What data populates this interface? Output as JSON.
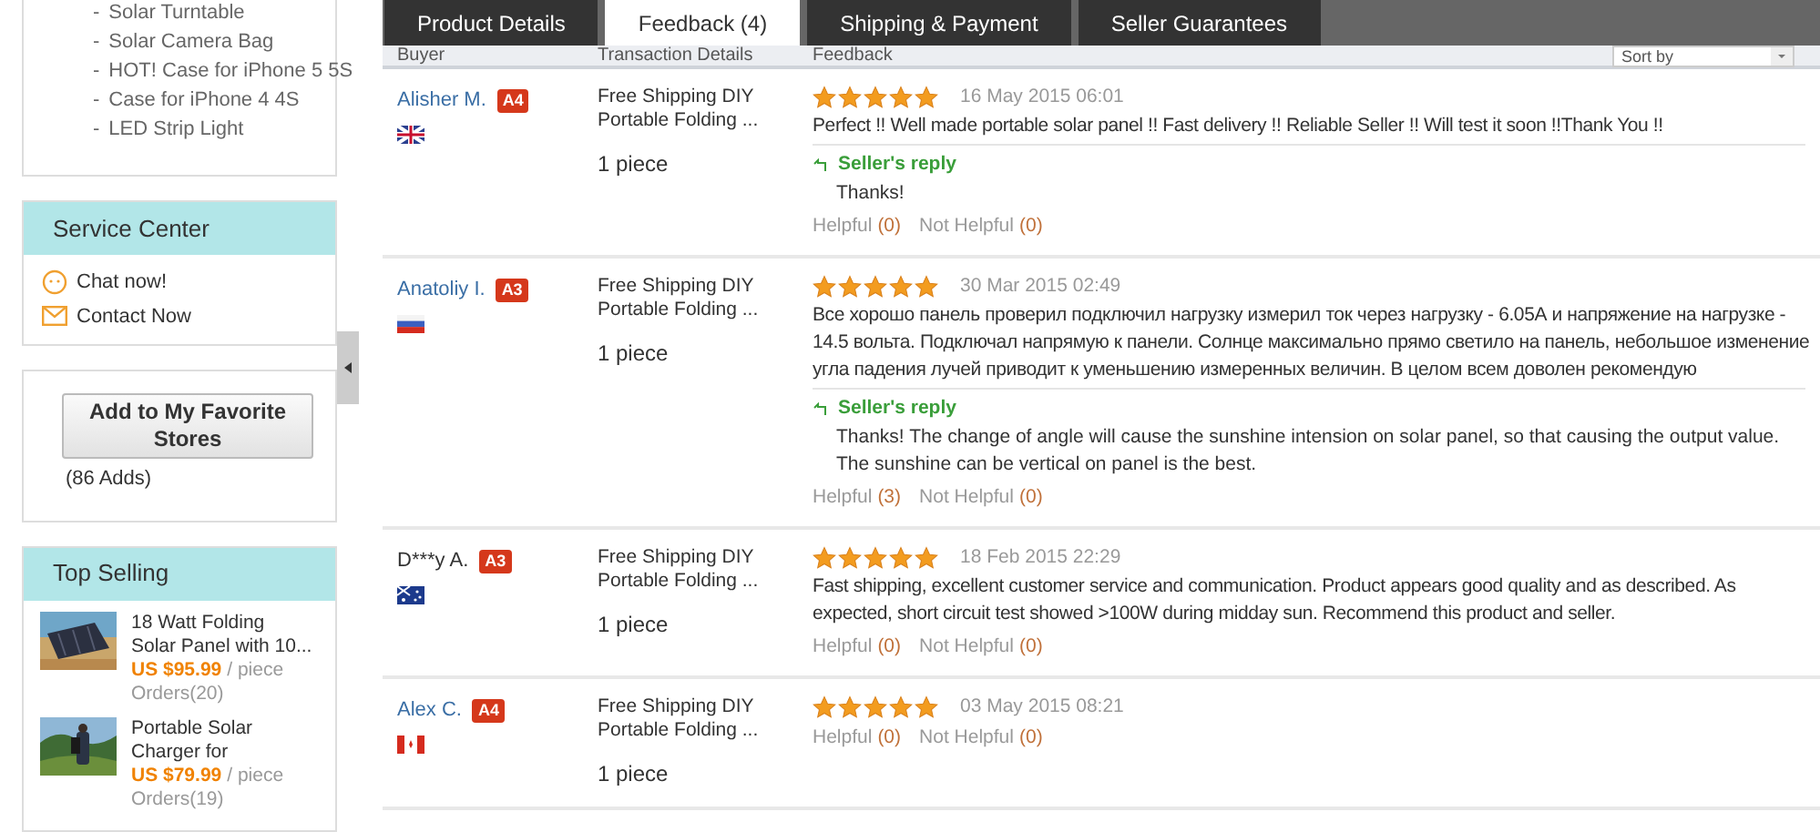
{
  "sidebar": {
    "category_links": [
      {
        "bullet": "-",
        "label": "Solar Turntable"
      },
      {
        "bullet": "-",
        "label": "Solar Camera Bag"
      },
      {
        "bullet": "-",
        "label": "HOT! Case for iPhone 5 5S"
      },
      {
        "bullet": "-",
        "label": "Case for iPhone 4 4S"
      },
      {
        "bullet": "-",
        "label": "LED Strip Light"
      }
    ],
    "service_center": {
      "title": "Service Center",
      "links": [
        {
          "label": "Chat now!",
          "kind": "chat"
        },
        {
          "label": "Contact Now",
          "kind": "mail"
        }
      ]
    },
    "favorite": {
      "button": "Add to My Favorite Stores",
      "count": "(86 Adds)"
    },
    "top_selling": {
      "title": "Top Selling",
      "items": [
        {
          "title": "18 Watt Folding Solar Panel with 10...",
          "price": "US $95.99",
          "unit": "/ piece",
          "orders": "Orders(20)",
          "kind": "picture"
        },
        {
          "title": "Portable Solar Charger for",
          "price": "US $79.99",
          "unit": "/ piece",
          "orders": "Orders(19)",
          "kind": "picture"
        }
      ]
    }
  },
  "tabs": [
    {
      "label": "Product Details",
      "selected": false
    },
    {
      "label": "Feedback (4)",
      "selected": true
    },
    {
      "label": "Shipping & Payment",
      "selected": false
    },
    {
      "label": "Seller Guarantees",
      "selected": false
    }
  ],
  "table": {
    "columns": [
      "Buyer",
      "Transaction Details",
      "Feedback"
    ],
    "sort": {
      "value": "Sort by"
    },
    "rows": [
      {
        "buyer": "Alisher M.",
        "buyer_link": true,
        "level": "A4",
        "flag": {
          "kind": "uk"
        },
        "product": "Free Shipping DIY Portable Folding ...",
        "quantity": "1 piece",
        "stars": 5,
        "date": "16 May 2015 06:01",
        "comment": "Perfect !! Well made portable solar panel !! Fast delivery !! Reliable Seller !! Will test it soon !!Thank You !!",
        "reply": {
          "label": "Seller's reply",
          "text": "Thanks!"
        },
        "helpful": "Helpful",
        "helpful_count": "(0)",
        "not_helpful": "Not Helpful",
        "not_helpful_count": "(0)"
      },
      {
        "buyer": "Anatoliy I.",
        "buyer_link": true,
        "level": "A3",
        "flag": {
          "kind": "ru"
        },
        "product": "Free Shipping DIY Portable Folding ...",
        "quantity": "1 piece",
        "stars": 5,
        "date": "30 Mar 2015 02:49",
        "comment": "Все хорошо панель проверил подключил нагрузку измерил ток через нагрузку - 6.05А и напряжение на нагрузке - 14.5 вольта. Подключал напрямую к панели. Солнце максимально прямо светило на панель, небольшое изменение угла падения лучей приводит к уменьшению измеренных величин. В целом всем доволен рекомендую",
        "reply": {
          "label": "Seller's reply",
          "text": "Thanks! The change of angle will cause the sunshine intension on solar panel, so that causing the output value. The sunshine can be vertical on panel is the best."
        },
        "helpful": "Helpful",
        "helpful_count": "(3)",
        "not_helpful": "Not Helpful",
        "not_helpful_count": "(0)"
      },
      {
        "buyer": "D***y A.",
        "buyer_link": false,
        "level": "A3",
        "flag": {
          "kind": "au"
        },
        "product": "Free Shipping DIY Portable Folding ...",
        "quantity": "1 piece",
        "stars": 5,
        "date": "18 Feb 2015 22:29",
        "comment": "Fast shipping, excellent customer service and communication. Product appears good quality and as described. As expected, short circuit test showed >100W during midday sun. Recommend this product and seller.",
        "helpful": "Helpful",
        "helpful_count": "(0)",
        "not_helpful": "Not Helpful",
        "not_helpful_count": "(0)"
      },
      {
        "buyer": "Alex C.",
        "buyer_link": true,
        "level": "A4",
        "flag": {
          "kind": "ca"
        },
        "product": "Free Shipping DIY Portable Folding ...",
        "quantity": "1 piece",
        "stars": 5,
        "date": "03 May 2015 08:21",
        "helpful": "Helpful",
        "helpful_count": "(0)",
        "not_helpful": "Not Helpful",
        "not_helpful_count": "(0)"
      }
    ]
  }
}
